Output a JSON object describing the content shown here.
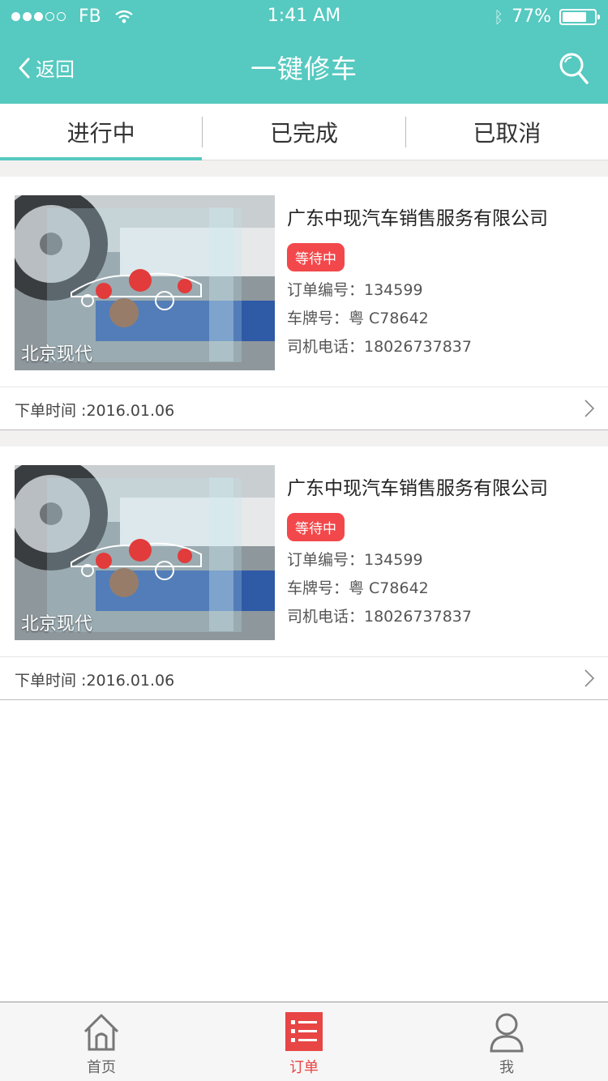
{
  "status_bar": {
    "carrier": "FB",
    "time": "1:41 AM",
    "battery": "77%",
    "battery_level": 0.77
  },
  "nav": {
    "back_label": "返回",
    "title": "一键修车"
  },
  "tabs": [
    {
      "label": "进行中",
      "active": true
    },
    {
      "label": "已完成",
      "active": false
    },
    {
      "label": "已取消",
      "active": false
    }
  ],
  "orders": [
    {
      "image_label": "北京现代",
      "company": "广东中现汽车销售服务有限公司",
      "status": "等待中",
      "order_no": "订单编号：134599",
      "plate": "车牌号：粤 C78642",
      "phone": "司机电话：18026737837",
      "time": "下单时间 :2016.01.06"
    },
    {
      "image_label": "北京现代",
      "company": "广东中现汽车销售服务有限公司",
      "status": "等待中",
      "order_no": "订单编号：134599",
      "plate": "车牌号：粤 C78642",
      "phone": "司机电话：18026737837",
      "time": "下单时间 :2016.01.06"
    }
  ],
  "tabbar": [
    {
      "label": "首页",
      "icon": "home-icon",
      "active": false
    },
    {
      "label": "订单",
      "icon": "order-list-icon",
      "active": true
    },
    {
      "label": "我",
      "icon": "user-icon",
      "active": false
    }
  ],
  "colors": {
    "primary": "#56c9c0",
    "badge": "#f2484b",
    "active_tab": "#e84545"
  }
}
